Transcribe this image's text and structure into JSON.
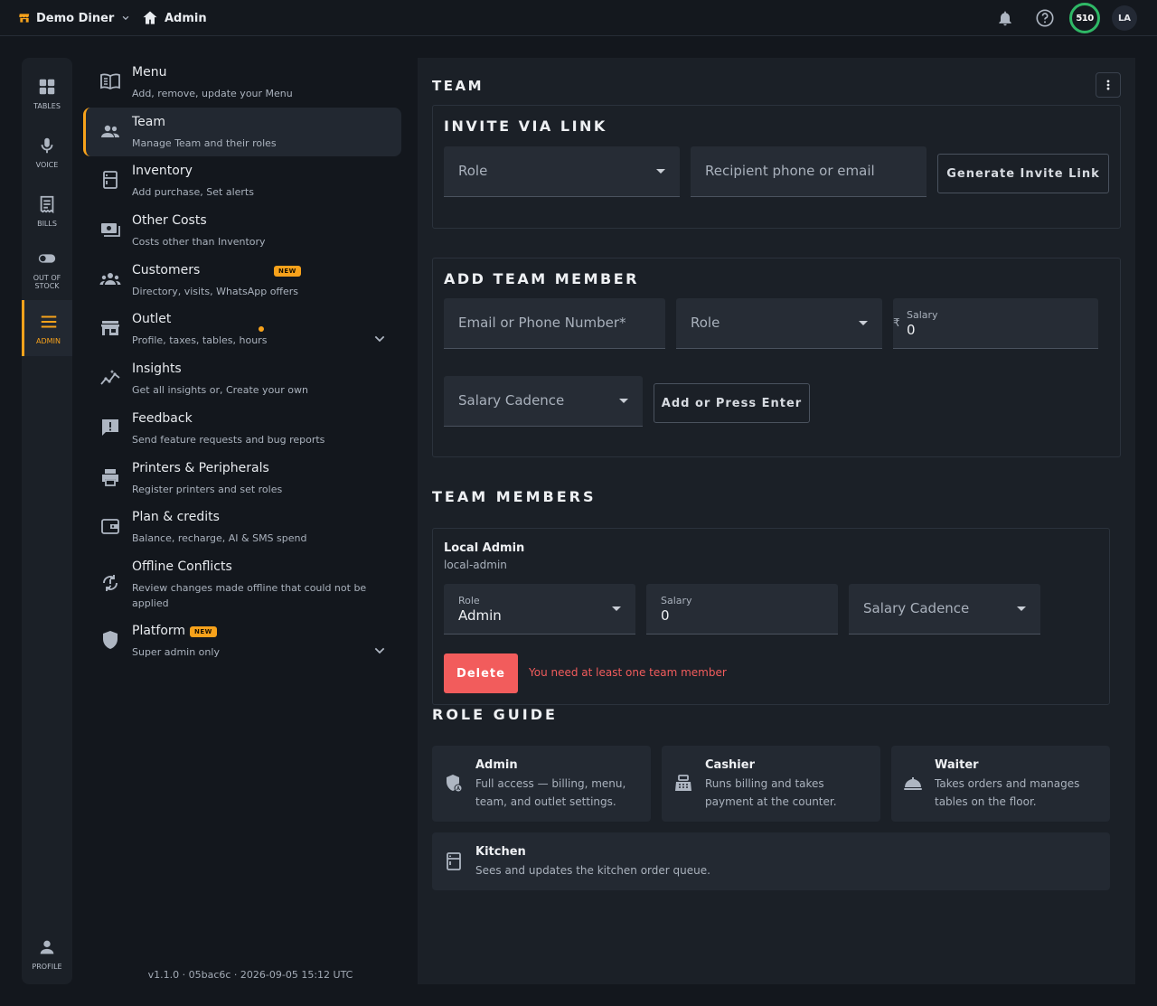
{
  "topbar": {
    "restaurant": "Demo Diner",
    "section": "Admin",
    "credits": "510",
    "user_initials": "LA",
    "icons": {
      "store": "store-icon",
      "home": "home-icon",
      "notifications": "bell-icon",
      "help": "help-icon"
    }
  },
  "rail": {
    "items": [
      {
        "label": "TABLES",
        "icon": "grid-icon"
      },
      {
        "label": "VOICE",
        "icon": "mic-icon"
      },
      {
        "label": "BILLS",
        "icon": "receipt-icon"
      },
      {
        "label": "OUT OF STOCK",
        "icon": "toggle-icon"
      },
      {
        "label": "ADMIN",
        "icon": "hamburger-icon",
        "active": true
      }
    ],
    "profile": {
      "label": "PROFILE",
      "icon": "person-icon"
    }
  },
  "menu": {
    "items": [
      {
        "title": "Menu",
        "subtitle": "Add, remove, update your Menu",
        "icon": "book-icon"
      },
      {
        "title": "Team",
        "subtitle": "Manage Team and their roles",
        "icon": "people-icon",
        "active": true
      },
      {
        "title": "Inventory",
        "subtitle": "Add purchase, Set alerts",
        "icon": "fridge-icon"
      },
      {
        "title": "Other Costs",
        "subtitle": "Costs other than Inventory",
        "icon": "cash-icon"
      },
      {
        "title": "Customers",
        "subtitle": "Directory, visits, WhatsApp offers",
        "icon": "groups-icon",
        "badge": "NEW"
      },
      {
        "title": "Outlet",
        "subtitle": "Profile, taxes, tables, hours",
        "icon": "storefront-icon"
      },
      {
        "title": "Insights",
        "subtitle": "Get all insights or, Create your own",
        "icon": "insights-icon"
      },
      {
        "title": "Feedback",
        "subtitle": "Send feature requests and bug reports",
        "icon": "feedback-icon"
      },
      {
        "title": "Printers & Peripherals",
        "subtitle": "Register printers and set roles",
        "icon": "printer-icon"
      },
      {
        "title": "Plan & credits",
        "subtitle": "Balance, recharge, AI & SMS spend",
        "icon": "wallet-icon"
      },
      {
        "title": "Offline Conflicts",
        "subtitle": "Review changes made offline that could not be applied",
        "icon": "sync-icon"
      },
      {
        "title": "Platform",
        "subtitle": "Super admin only",
        "icon": "shield-icon",
        "badge": "NEW"
      }
    ]
  },
  "version": "v1.1.0 · 05bac6c · 2026-09-05 15:12 UTC",
  "team": {
    "title": "TEAM",
    "invite": {
      "title": "INVITE VIA LINK",
      "role_placeholder": "Role",
      "recipient_placeholder": "Recipient phone or email",
      "button": "Generate Invite Link"
    },
    "add": {
      "title": "ADD TEAM MEMBER",
      "email_placeholder": "Email or Phone Number*",
      "role_placeholder": "Role",
      "salary_label": "Salary",
      "currency": "₹",
      "salary_value": "0",
      "cadence_placeholder": "Salary Cadence",
      "button": "Add or Press Enter"
    },
    "members_title": "TEAM MEMBERS",
    "members": [
      {
        "name": "Local Admin",
        "handle": "local-admin",
        "role_label": "Role",
        "role": "Admin",
        "salary_label": "Salary",
        "salary": "0",
        "cadence_placeholder": "Salary Cadence",
        "delete_label": "Delete",
        "error": "You need at least one team member"
      }
    ],
    "role_guide_title": "ROLE GUIDE",
    "roles": [
      {
        "title": "Admin",
        "desc1": "Full access — billing, menu,",
        "desc2": "team, and outlet settings.",
        "icon": "admin-shield-icon"
      },
      {
        "title": "Cashier",
        "desc1": "Runs billing and takes",
        "desc2": "payment at the counter.",
        "icon": "register-icon"
      },
      {
        "title": "Waiter",
        "desc1": "Takes orders and manages",
        "desc2": "tables on the floor.",
        "icon": "cloche-icon"
      },
      {
        "title": "Kitchen",
        "desc1": "Sees and updates the kitchen order queue.",
        "desc2": "",
        "icon": "kitchen-icon"
      }
    ]
  },
  "colors": {
    "accent": "#f7a21b",
    "danger": "#f25c5c",
    "credits_ring": "#2fb866",
    "panel": "#1b2027",
    "background": "#13171d"
  }
}
